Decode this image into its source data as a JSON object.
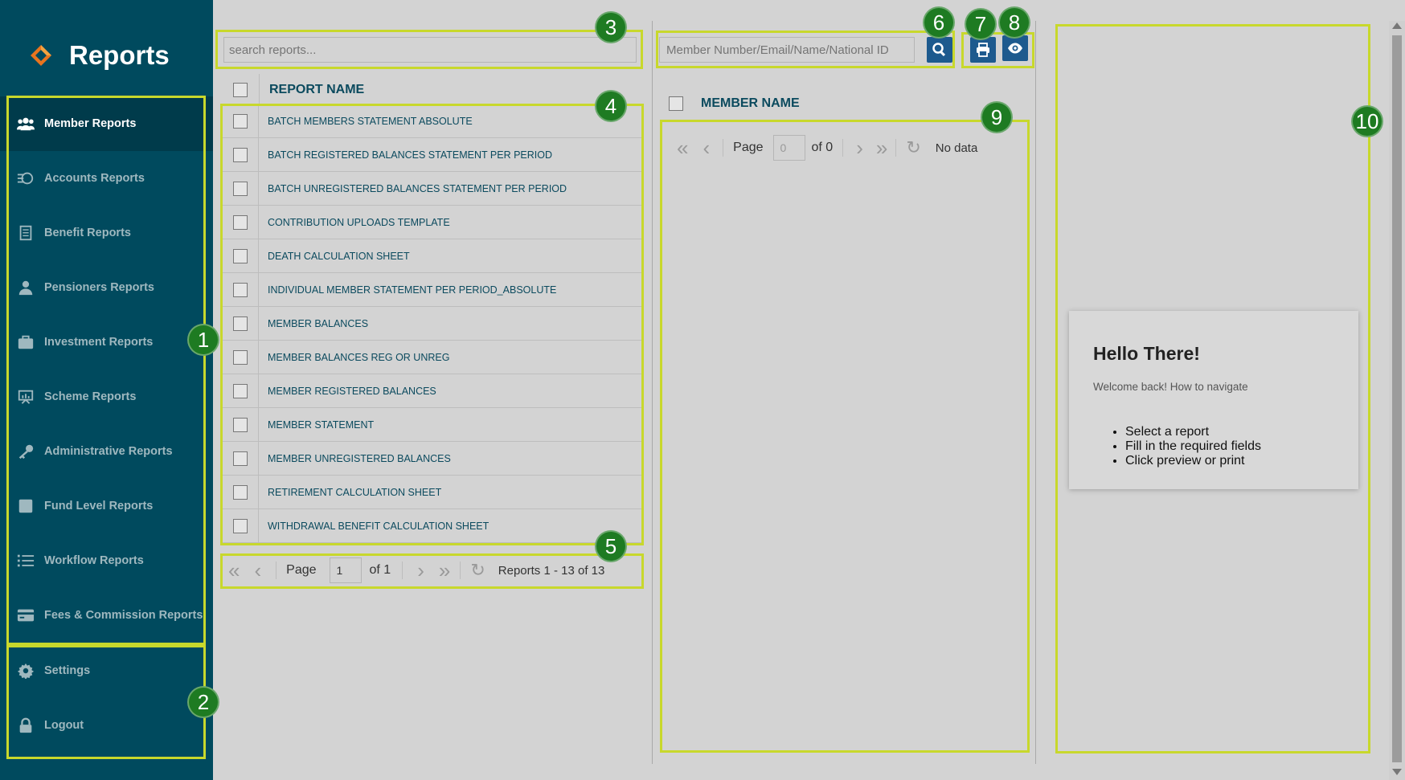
{
  "sidebar": {
    "title": "Reports",
    "items": [
      {
        "label": "Member Reports",
        "icon": "users-icon",
        "active": true
      },
      {
        "label": "Accounts Reports",
        "icon": "coins-icon"
      },
      {
        "label": "Benefit Reports",
        "icon": "document-icon"
      },
      {
        "label": "Pensioners Reports",
        "icon": "user-icon"
      },
      {
        "label": "Investment Reports",
        "icon": "briefcase-icon"
      },
      {
        "label": "Scheme Reports",
        "icon": "presentation-icon"
      },
      {
        "label": "Administrative Reports",
        "icon": "key-icon"
      },
      {
        "label": "Fund Level Reports",
        "icon": "square-icon"
      },
      {
        "label": "Workflow Reports",
        "icon": "list-icon"
      },
      {
        "label": "Fees & Commission Reports",
        "icon": "credit-card-icon"
      }
    ],
    "bottom_items": [
      {
        "label": "Settings",
        "icon": "gear-icon"
      },
      {
        "label": "Logout",
        "icon": "lock-icon"
      }
    ]
  },
  "reports": {
    "search_placeholder": "search reports...",
    "column_header": "REPORT NAME",
    "rows": [
      "BATCH MEMBERS STATEMENT ABSOLUTE",
      "BATCH REGISTERED BALANCES STATEMENT PER PERIOD",
      "BATCH UNREGISTERED BALANCES STATEMENT PER PERIOD",
      "CONTRIBUTION UPLOADS TEMPLATE",
      "DEATH CALCULATION SHEET",
      "INDIVIDUAL MEMBER STATEMENT PER PERIOD_ABSOLUTE",
      "MEMBER BALANCES",
      "MEMBER BALANCES REG OR UNREG",
      "MEMBER REGISTERED BALANCES",
      "MEMBER STATEMENT",
      "MEMBER UNREGISTERED BALANCES",
      "RETIREMENT CALCULATION SHEET",
      "WITHDRAWAL BENEFIT CALCULATION SHEET"
    ],
    "pager": {
      "page_label": "Page",
      "page_value": "1",
      "of_label": "of 1",
      "summary": "Reports 1 - 13 of 13"
    }
  },
  "members": {
    "search_placeholder": "Member Number/Email/Name/National ID",
    "column_header": "MEMBER NAME",
    "pager": {
      "page_label": "Page",
      "page_value": "0",
      "of_label": "of 0",
      "summary": "No data"
    }
  },
  "welcome": {
    "title": "Hello There!",
    "subtitle": "Welcome back! How to navigate",
    "steps": [
      "Select a report",
      "Fill in the required fields",
      "Click preview or print"
    ]
  },
  "annotations": [
    "1",
    "2",
    "3",
    "4",
    "5",
    "6",
    "7",
    "8",
    "9",
    "10"
  ],
  "colors": {
    "sidebar": "#004a5e",
    "accent": "#c8d82c",
    "badge": "#1e7b22",
    "button": "#1d5a8e"
  }
}
